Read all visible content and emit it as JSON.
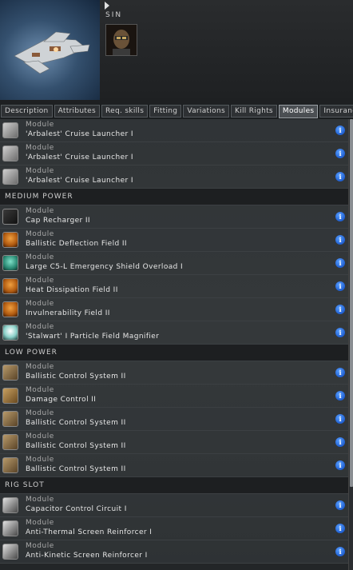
{
  "pilot": {
    "name": "SIN"
  },
  "tabs": [
    {
      "label": "Description",
      "active": false
    },
    {
      "label": "Attributes",
      "active": false
    },
    {
      "label": "Req. skills",
      "active": false
    },
    {
      "label": "Fitting",
      "active": false
    },
    {
      "label": "Variations",
      "active": false
    },
    {
      "label": "Kill Rights",
      "active": false
    },
    {
      "label": "Modules",
      "active": true
    },
    {
      "label": "Insurance",
      "active": false
    }
  ],
  "sections": [
    {
      "title": "",
      "modules": [
        {
          "type": "Module",
          "name": "'Arbalest' Cruise Launcher I",
          "icon": "launcher-icon"
        },
        {
          "type": "Module",
          "name": "'Arbalest' Cruise Launcher I",
          "icon": "launcher-icon"
        },
        {
          "type": "Module",
          "name": "'Arbalest' Cruise Launcher I",
          "icon": "launcher-icon"
        }
      ]
    },
    {
      "title": "MEDIUM POWER",
      "modules": [
        {
          "type": "Module",
          "name": "Cap Recharger II",
          "icon": "cap-recharger-icon"
        },
        {
          "type": "Module",
          "name": "Ballistic Deflection Field II",
          "icon": "shield-hardener-orange-icon"
        },
        {
          "type": "Module",
          "name": "Large C5-L Emergency Shield Overload I",
          "icon": "shield-booster-teal-icon"
        },
        {
          "type": "Module",
          "name": "Heat Dissipation Field II",
          "icon": "shield-hardener-orange-icon"
        },
        {
          "type": "Module",
          "name": "Invulnerability Field II",
          "icon": "shield-hardener-orange-icon"
        },
        {
          "type": "Module",
          "name": "'Stalwart' I Particle Field Magnifier",
          "icon": "shield-amplifier-icon"
        }
      ]
    },
    {
      "title": "LOW POWER",
      "modules": [
        {
          "type": "Module",
          "name": "Ballistic Control System II",
          "icon": "ballistic-control-icon"
        },
        {
          "type": "Module",
          "name": "Damage Control II",
          "icon": "damage-control-icon"
        },
        {
          "type": "Module",
          "name": "Ballistic Control System II",
          "icon": "ballistic-control-icon"
        },
        {
          "type": "Module",
          "name": "Ballistic Control System II",
          "icon": "ballistic-control-icon"
        },
        {
          "type": "Module",
          "name": "Ballistic Control System II",
          "icon": "ballistic-control-icon"
        }
      ]
    },
    {
      "title": "RIG SLOT",
      "modules": [
        {
          "type": "Module",
          "name": "Capacitor Control Circuit I",
          "icon": "rig-icon"
        },
        {
          "type": "Module",
          "name": "Anti-Thermal Screen Reinforcer I",
          "icon": "rig-icon"
        },
        {
          "type": "Module",
          "name": "Anti-Kinetic Screen Reinforcer I",
          "icon": "rig-icon"
        }
      ]
    }
  ],
  "info_glyph": "i",
  "colors": {
    "info_button": "#1f5fd1",
    "active_tab": "#4b4f53",
    "background": "#1b1e20"
  }
}
